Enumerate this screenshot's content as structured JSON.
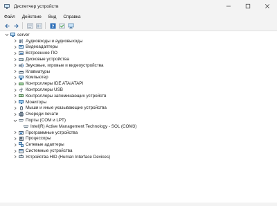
{
  "window": {
    "title": "Диспетчер устройств",
    "icon": "device-manager-icon",
    "controls": [
      "minimize-icon",
      "maximize-icon",
      "close-icon"
    ]
  },
  "menu": [
    "Файл",
    "Действие",
    "Вид",
    "Справка"
  ],
  "toolbar": [
    "back-arrow-icon",
    "forward-arrow-icon",
    "properties-icon",
    "show-hidden-icon",
    "help-icon",
    "driver-update-icon",
    "scan-hardware-icon"
  ],
  "tree": {
    "root": {
      "label": "server",
      "icon": "computer-icon",
      "expanded": true
    },
    "categories": [
      {
        "label": "Аудиовходы и аудиовыходы",
        "icon": "audio-icon",
        "expanded": false
      },
      {
        "label": "Видеоадаптеры",
        "icon": "display-adapter-icon",
        "expanded": false
      },
      {
        "label": "Встроенное ПО",
        "icon": "firmware-icon",
        "expanded": false
      },
      {
        "label": "Дисковые устройства",
        "icon": "disk-icon",
        "expanded": false
      },
      {
        "label": "Звуковые, игровые и видеоустройства",
        "icon": "sound-icon",
        "expanded": false
      },
      {
        "label": "Клавиатуры",
        "icon": "keyboard-icon",
        "expanded": false
      },
      {
        "label": "Компьютер",
        "icon": "computer-small-icon",
        "expanded": false
      },
      {
        "label": "Контроллеры IDE ATA/ATAPI",
        "icon": "ide-controller-icon",
        "expanded": false
      },
      {
        "label": "Контроллеры USB",
        "icon": "usb-icon",
        "expanded": false
      },
      {
        "label": "Контроллеры запоминающих устройств",
        "icon": "storage-controller-icon",
        "expanded": false
      },
      {
        "label": "Мониторы",
        "icon": "monitor-icon",
        "expanded": false
      },
      {
        "label": "Мыши и иные указывающие устройства",
        "icon": "mouse-icon",
        "expanded": false
      },
      {
        "label": "Очереди печати",
        "icon": "printer-icon",
        "expanded": false
      },
      {
        "label": "Порты (COM и LPT)",
        "icon": "port-icon",
        "expanded": true,
        "children": [
          {
            "label": "Intel(R) Active Management Technology - SOL (COM3)",
            "icon": "port-device-icon"
          }
        ]
      },
      {
        "label": "Программные устройства",
        "icon": "software-device-icon",
        "expanded": false
      },
      {
        "label": "Процессоры",
        "icon": "processor-icon",
        "expanded": false
      },
      {
        "label": "Сетевые адаптеры",
        "icon": "network-adapter-icon",
        "expanded": false
      },
      {
        "label": "Системные устройства",
        "icon": "system-device-icon",
        "expanded": false
      },
      {
        "label": "Устройства HID (Human Interface Devices)",
        "icon": "hid-icon",
        "expanded": false
      }
    ]
  },
  "colors": {
    "chrome": "#f3f3f3",
    "icon_blue": "#3d7fc1",
    "icon_gray": "#6f7f90",
    "text": "#1a1a1a"
  }
}
